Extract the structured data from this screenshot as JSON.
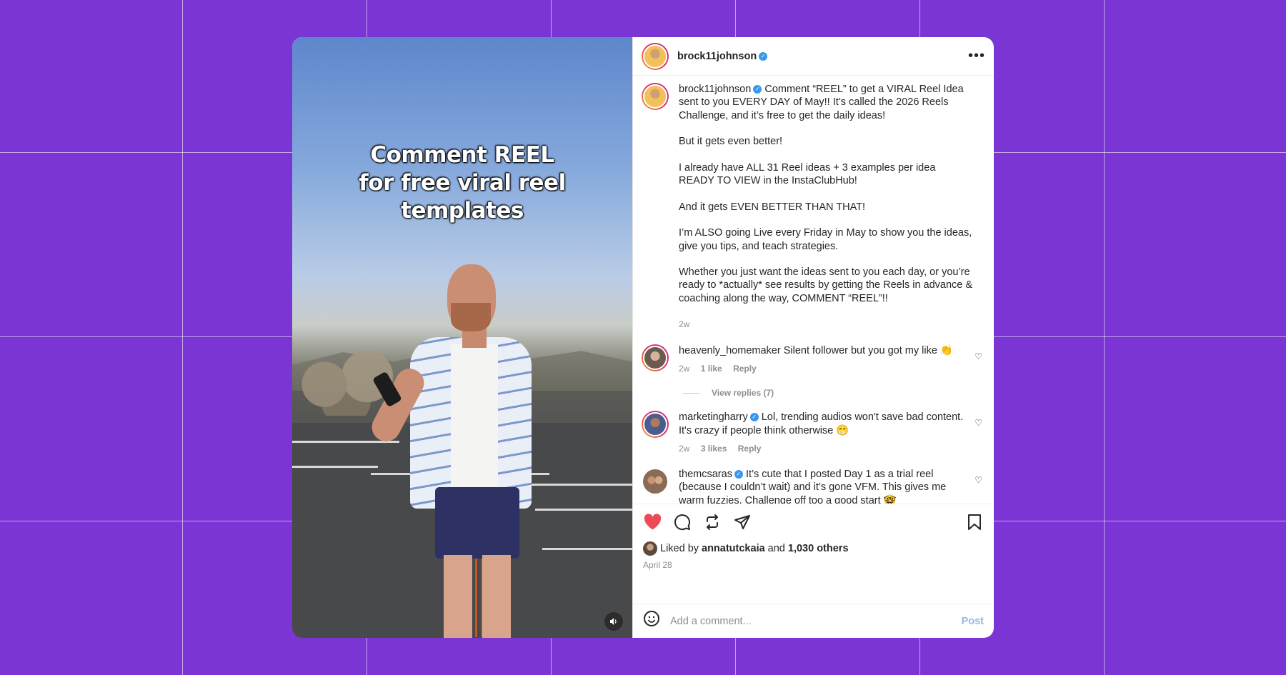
{
  "post": {
    "author": "brock11johnson",
    "overlay_text": "Comment REEL\nfor free viral reel\ntemplates",
    "caption": {
      "author": "brock11johnson",
      "paragraphs": [
        "Comment “REEL” to get a VIRAL Reel Idea sent to you EVERY DAY of May!! It’s called the 2026 Reels Challenge, and it’s free to get the daily ideas!",
        "But it gets even better!",
        "I already have ALL 31 Reel ideas + 3 examples per idea READY TO VIEW in the InstaClubHub!",
        "And it gets EVEN BETTER THAN THAT!",
        "I’m ALSO going Live every Friday in May to show you the ideas, give you tips, and teach strategies.",
        "Whether you just want the ideas sent to you each day, or you’re ready to *actually* see results by getting the Reels in advance & coaching along the way, COMMENT “REEL”!!"
      ],
      "age": "2w"
    },
    "comments": [
      {
        "username": "heavenly_homemaker",
        "text": "Silent follower but you got my like 👏",
        "age": "2w",
        "likes": "1 like",
        "reply": "Reply",
        "view_replies": "View replies (7)"
      },
      {
        "username": "marketingharry",
        "text": "Lol, trending audios won't save bad content. It's crazy if people think otherwise 😁",
        "age": "2w",
        "likes": "3 likes",
        "reply": "Reply"
      },
      {
        "username": "themcsaras",
        "text": "It’s cute that I posted Day 1 as a trial reel (because I couldn’t wait) and it’s gone VFM. This gives me warm fuzzies. Challenge off too a good start 🤓"
      }
    ],
    "liked_by": {
      "prefix": "Liked by",
      "user": "annatutckaia",
      "joiner": "and",
      "others": "1,030 others"
    },
    "date": "April 28",
    "add_comment": {
      "placeholder": "Add a comment...",
      "post_label": "Post"
    },
    "icons": {
      "like": "heart-filled-icon",
      "comment": "comment-bubble-icon",
      "repost": "repost-icon",
      "share": "send-icon",
      "save": "bookmark-icon",
      "more": "more-horizontal-icon",
      "emoji": "emoji-icon",
      "mute": "speaker-icon"
    },
    "colors": {
      "background": "#7b35d4",
      "like": "#ed4956",
      "verified": "#3897f0"
    }
  }
}
